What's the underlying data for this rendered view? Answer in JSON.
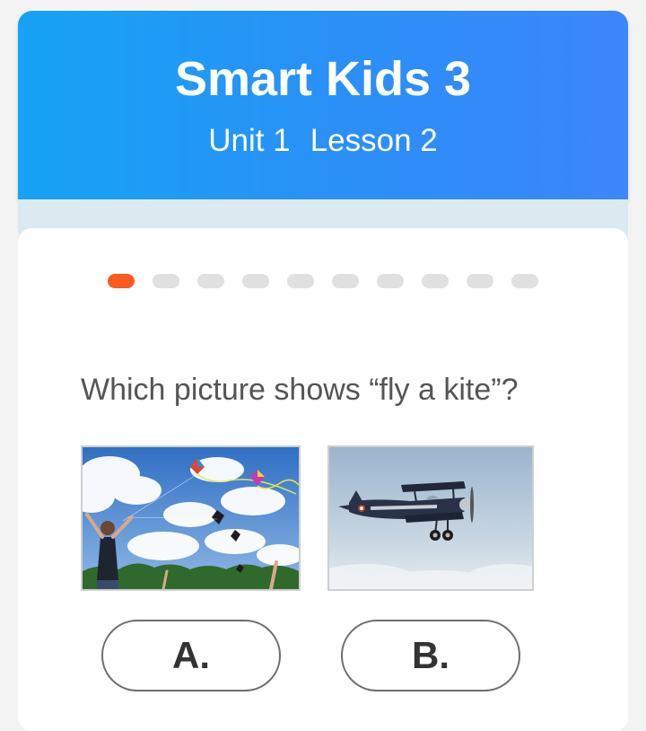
{
  "header": {
    "title": "Smart Kids 3",
    "unit": "Unit 1",
    "lesson": "Lesson 2"
  },
  "progress": {
    "total_steps": 10,
    "current_step": 1,
    "active_color": "#fb5a22",
    "inactive_color": "#e0e0e0"
  },
  "question": {
    "text": "Which picture shows “fly a kite”?"
  },
  "options": [
    {
      "label": "A.",
      "image": "people-flying-kites-photo"
    },
    {
      "label": "B.",
      "image": "biplane-photo"
    }
  ],
  "colors": {
    "header_gradient_start": "#16a3f5",
    "header_gradient_end": "#3c85fb"
  }
}
